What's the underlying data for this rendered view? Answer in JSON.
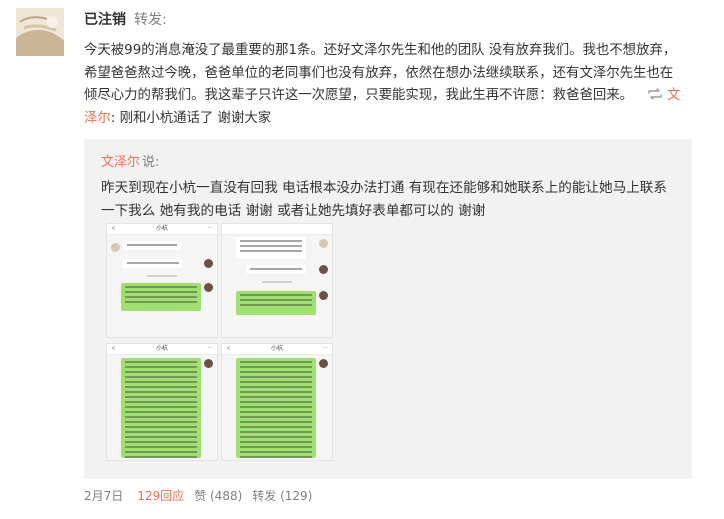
{
  "post": {
    "username": "已注销",
    "action": "转发:",
    "content_main": "今天被99的消息淹没了最重要的那1条。还好文泽尔先生和他的团队 没有放弃我们。我也不想放弃，希望爸爸熬过今晚，爸爸单位的老同事们也没有放弃，依然在想办法继续联系，还有文泽尔先生也在倾尽心力的帮我们。我这辈子只许这一次愿望，只要能实现，我此生再不许愿：救爸爸回来。",
    "repost_name": "文泽尔",
    "repost_sep": ":",
    "repost_text": "刚和小杭通话了 谢谢大家"
  },
  "quote": {
    "author": "文泽尔",
    "said": "说:",
    "text": "昨天到现在小杭一直没有回我 电话根本没办法打通 有现在还能够和她联系上的能让她马上联系一下我么 她有我的电话 谢谢 或者让她先填好表单都可以的 谢谢",
    "thumbnails": [
      {
        "title": "小杭",
        "back": "<",
        "more": "···"
      },
      {
        "title": "",
        "back": "",
        "more": ""
      },
      {
        "title": "小杭",
        "back": "<",
        "more": "···"
      },
      {
        "title": "小杭",
        "back": "<",
        "more": "···"
      }
    ]
  },
  "footer": {
    "date": "2月7日",
    "reply": "129回应",
    "like": "赞 (488)",
    "repost": "转发 (129)"
  },
  "icons": {
    "avatar": "avatar-image",
    "repost": "repost-icon"
  },
  "colors": {
    "link": "#eb7350",
    "meta": "#808080",
    "quote_bg": "#f2f2f2",
    "chat_green": "#9fe06f"
  }
}
